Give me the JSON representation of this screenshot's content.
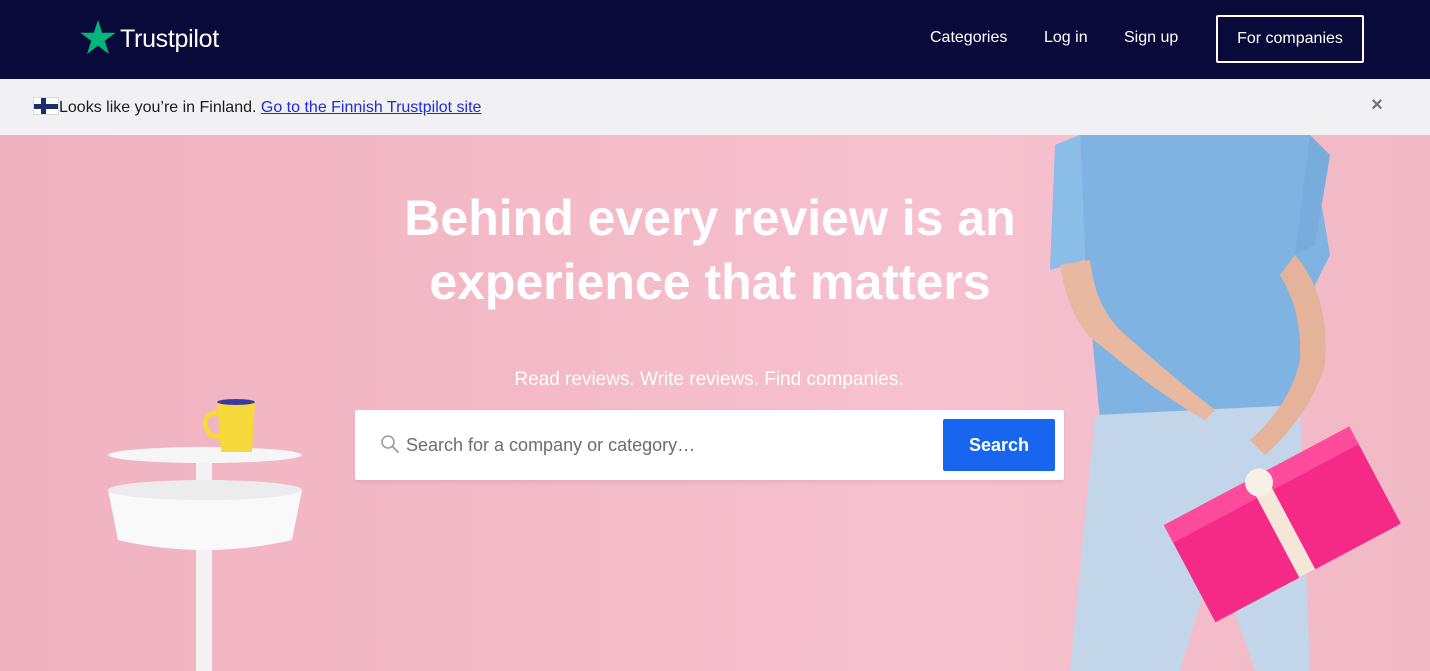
{
  "header": {
    "logo_text": "Trustpilot",
    "nav": {
      "categories": "Categories",
      "login": "Log in",
      "signup": "Sign up"
    },
    "cta": "For companies"
  },
  "notice": {
    "text": "Looks like you’re in Finland.",
    "link": "Go to the Finnish Trustpilot site",
    "flag_icon": "finland-flag-icon",
    "close_icon": "close-icon"
  },
  "hero": {
    "title_line1": "Behind every review is an",
    "title_line2": "experience that matters",
    "subtitle": "Read reviews. Write reviews. Find companies.",
    "search": {
      "placeholder": "Search for a company or category…",
      "button": "Search"
    }
  },
  "colors": {
    "header_bg": "#0a0a3a",
    "brand_star": "#00b67a",
    "search_button": "#1866f0",
    "hero_bg": "#f3b9c6"
  }
}
